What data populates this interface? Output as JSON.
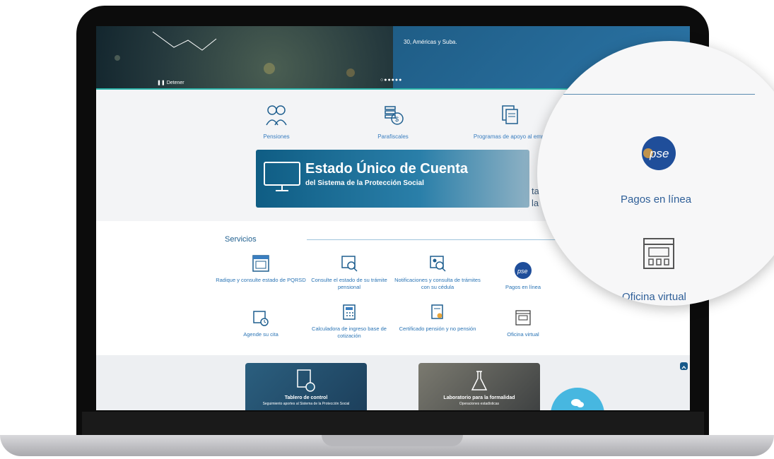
{
  "hero": {
    "caption": "30, Américas y Suba.",
    "stop_label": "Detener",
    "dots": "○●●●●●"
  },
  "categories": [
    {
      "label": "Pensiones",
      "icon": "elderly-people-icon"
    },
    {
      "label": "Parafiscales",
      "icon": "coins-icon"
    },
    {
      "label": "Programas de apoyo al empl",
      "icon": "documents-icon"
    }
  ],
  "banner": {
    "title": "Estado Único de Cuenta",
    "subtitle": "del Sistema de la Protección Social",
    "icon": "monitor-icon"
  },
  "behind_text": {
    "line1": "ta de",
    "line2": "la"
  },
  "servicios": {
    "title": "Servicios",
    "items": [
      {
        "label": "Radique y consulte estado de PQRSD",
        "icon": "form-window-icon"
      },
      {
        "label": "Consulte el estado de su trámite pensional",
        "icon": "document-search-icon"
      },
      {
        "label": "Notificaciones y consulta de trámites con su cédula",
        "icon": "id-search-icon"
      },
      {
        "label": "Pagos en línea",
        "icon": "pse-icon"
      },
      {
        "label": "Agende su cita",
        "icon": "calendar-clock-icon"
      },
      {
        "label": "Calculadora de ingreso base de cotización",
        "icon": "calculator-icon"
      },
      {
        "label": "Certificado pensión y no pensión",
        "icon": "certificate-icon"
      },
      {
        "label": "Oficina virtual",
        "icon": "virtual-office-icon"
      }
    ]
  },
  "cards": [
    {
      "title": "Tablero de control",
      "subtitle": "Seguimiento aportes al Sistema de la Protección Social",
      "icon": "chart-document-icon"
    },
    {
      "title": "Laboratorio para la formalidad",
      "subtitle": "Operaciones estadísticas",
      "icon": "flask-icon"
    }
  ],
  "magnifier": {
    "pse_text": "pse",
    "pagos_label": "Pagos en línea",
    "oficina_label": "Oficina virtual"
  },
  "colors": {
    "accent": "#3a7ec0",
    "teal": "#2bb2a8",
    "navy": "#0f5d84",
    "chat": "#47b7e0"
  }
}
